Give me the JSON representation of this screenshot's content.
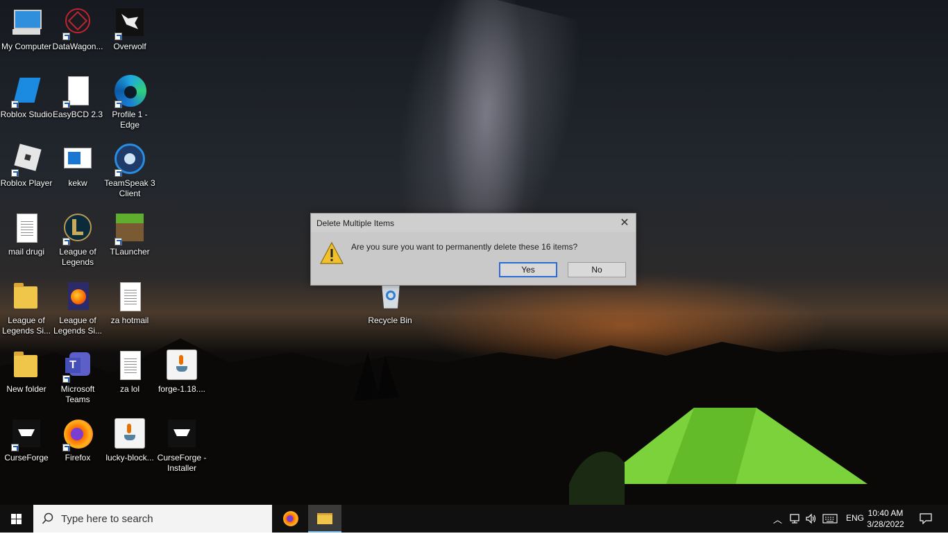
{
  "desktop": {
    "icons": [
      {
        "label": "My Computer",
        "icon": "computer-icon"
      },
      {
        "label": "DataWagon...",
        "icon": "datawagon-icon"
      },
      {
        "label": "Overwolf",
        "icon": "overwolf-icon"
      },
      {
        "label": "Roblox Studio",
        "icon": "roblox-studio-icon"
      },
      {
        "label": "EasyBCD 2.3",
        "icon": "file-icon"
      },
      {
        "label": "Profile 1 - Edge",
        "icon": "edge-icon"
      },
      {
        "label": "Roblox Player",
        "icon": "roblox-player-icon"
      },
      {
        "label": "kekw",
        "icon": "window-file-icon"
      },
      {
        "label": "TeamSpeak 3 Client",
        "icon": "teamspeak-icon"
      },
      {
        "label": "mail drugi",
        "icon": "text-file-icon"
      },
      {
        "label": "League of Legends",
        "icon": "league-icon"
      },
      {
        "label": "TLauncher",
        "icon": "tlauncher-icon"
      },
      {
        "label": "League of Legends Si...",
        "icon": "folder-icon"
      },
      {
        "label": "League of Legends Si...",
        "icon": "firefox-file-icon"
      },
      {
        "label": "za hotmail",
        "icon": "text-file-icon"
      },
      {
        "label": "New folder",
        "icon": "folder-icon"
      },
      {
        "label": "Microsoft Teams",
        "icon": "teams-icon"
      },
      {
        "label": "za lol",
        "icon": "text-file-icon"
      },
      {
        "label": "forge-1.18....",
        "icon": "java-icon"
      },
      {
        "label": "CurseForge",
        "icon": "curseforge-icon"
      },
      {
        "label": "Firefox",
        "icon": "firefox-icon"
      },
      {
        "label": "lucky-block...",
        "icon": "java-icon"
      },
      {
        "label": "CurseForge - Installer",
        "icon": "curseforge-icon"
      },
      {
        "label": "Recycle Bin",
        "icon": "recycle-bin-icon"
      }
    ]
  },
  "dialog": {
    "title": "Delete Multiple Items",
    "message": "Are you sure you want to permanently delete these 16 items?",
    "yes_label": "Yes",
    "no_label": "No",
    "close_icon": "close-icon"
  },
  "taskbar": {
    "search_placeholder": "Type here to search",
    "language": "ENG",
    "time": "10:40 AM",
    "date": "3/28/2022",
    "accent": "#76b9ed"
  }
}
